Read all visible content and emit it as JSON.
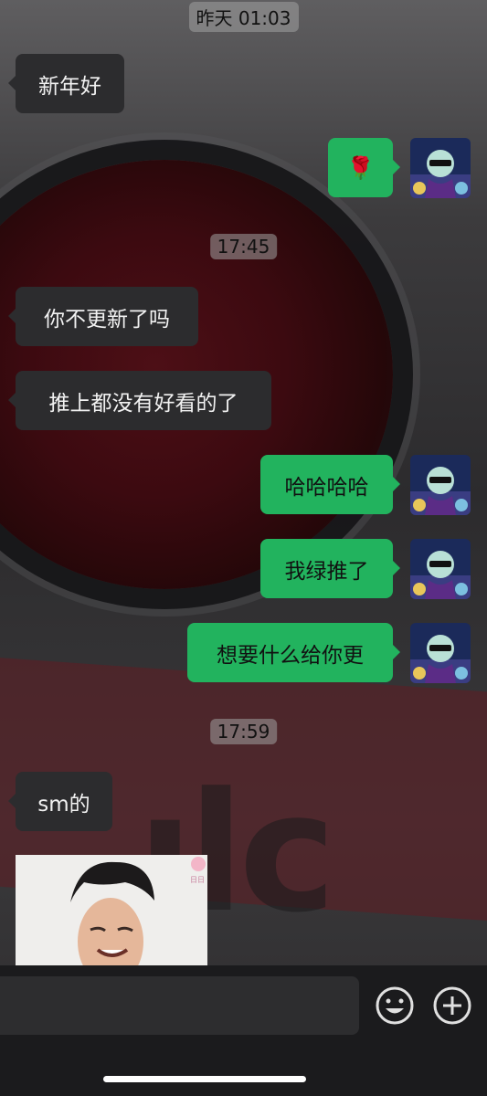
{
  "timestamps": {
    "t1": "昨天 01:03",
    "t2": "17:45",
    "t3": "17:59"
  },
  "messages": [
    {
      "side": "in",
      "text": "新年好"
    },
    {
      "side": "out",
      "text": "🌹",
      "icon": "rose-emoji"
    },
    {
      "side": "in",
      "text": "你不更新了吗"
    },
    {
      "side": "in",
      "text": "推上都没有好看的了"
    },
    {
      "side": "out",
      "text": "哈哈哈哈"
    },
    {
      "side": "out",
      "text": "我绿推了"
    },
    {
      "side": "out",
      "text": "想要什么给你更"
    },
    {
      "side": "in",
      "text": "sm的"
    },
    {
      "side": "in",
      "type": "image",
      "content": "photo of a smiling man",
      "sticker_text": "日日"
    }
  ],
  "input_bar": {
    "field_value": "",
    "icons": [
      "emoji-icon",
      "plus-icon"
    ]
  },
  "colors": {
    "outgoing_bubble": "#22b35e",
    "incoming_bubble": "#2c2c2e",
    "timestamp_bg": "#a0a0a0"
  },
  "avatar": {
    "description": "cartoon character with sunglasses"
  }
}
